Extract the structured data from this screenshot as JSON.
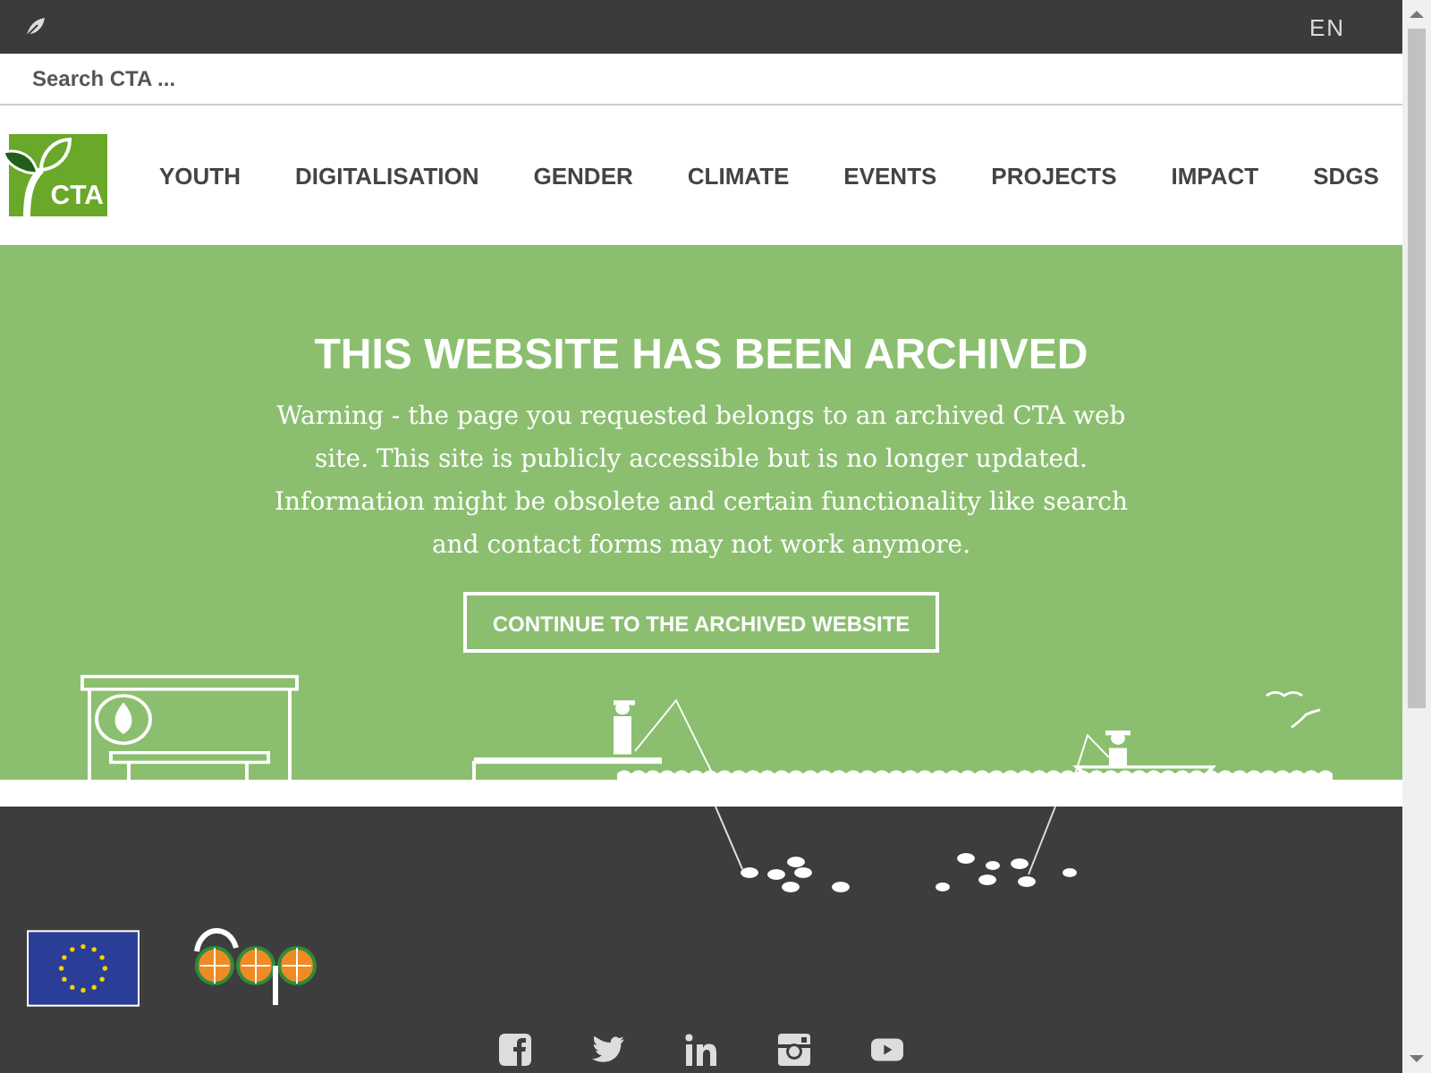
{
  "top_bar": {
    "language": "EN"
  },
  "search": {
    "placeholder": "Search CTA ..."
  },
  "logo": {
    "text": "CTA"
  },
  "nav": [
    {
      "label": "YOUTH"
    },
    {
      "label": "DIGITALISATION"
    },
    {
      "label": "GENDER"
    },
    {
      "label": "CLIMATE"
    },
    {
      "label": "EVENTS"
    },
    {
      "label": "PROJECTS"
    },
    {
      "label": "IMPACT"
    },
    {
      "label": "SDGS"
    }
  ],
  "hero": {
    "title": "THIS WEBSITE HAS BEEN ARCHIVED",
    "message": "Warning - the page you requested belongs to an archived CTA web site. This site is publicly accessible but is no longer updated. Information might be obsolete and certain functionality like search and contact forms may not work anymore.",
    "button": "CONTINUE TO THE ARCHIVED WEBSITE"
  }
}
